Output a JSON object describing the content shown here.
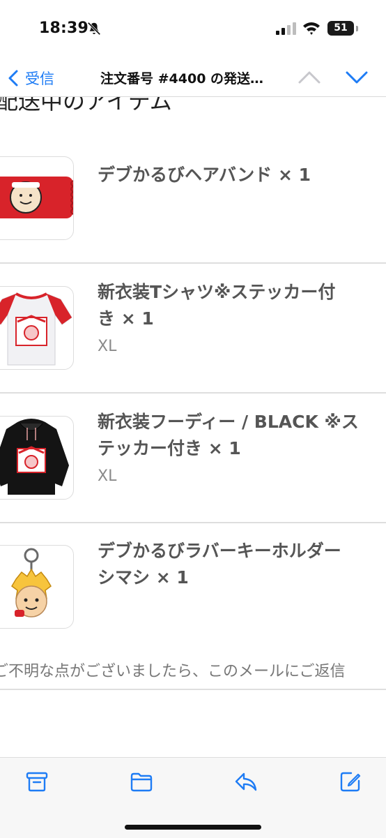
{
  "status_bar": {
    "time": "18:39",
    "battery_percent": "51",
    "icons": [
      "bell-slash-icon",
      "cellular-signal-icon",
      "wifi-icon",
      "battery-icon"
    ]
  },
  "nav": {
    "back_label": "受信",
    "title": "注文番号 #4400 の発送…",
    "icons": [
      "chevron-left-icon",
      "chevron-up-icon",
      "chevron-down-icon"
    ]
  },
  "section_heading": "配送中のアイテム",
  "items": [
    {
      "title_lines": [
        "デブかるびヘアバンド × 1"
      ],
      "variant": ""
    },
    {
      "title_lines": [
        "新衣装Tシャツ※ステッカー付",
        "き × 1"
      ],
      "variant": "XL"
    },
    {
      "title_lines": [
        "新衣装フーディー / BLACK ※ス",
        "テッカー付き × 1"
      ],
      "variant": "XL"
    },
    {
      "title_lines": [
        "デブかるびラバーキーホルダー",
        "シマシ × 1"
      ],
      "variant": ""
    }
  ],
  "footer_text": "ご不明な点がございましたら、このメールにご返信",
  "toolbar": {
    "icons": [
      "archive-icon",
      "folder-icon",
      "reply-icon",
      "compose-icon"
    ]
  },
  "colors": {
    "accent": "#1e7cf5",
    "product_red": "#d8232a",
    "text_gray": "#555555",
    "variant_gray": "#8a8a8a"
  }
}
